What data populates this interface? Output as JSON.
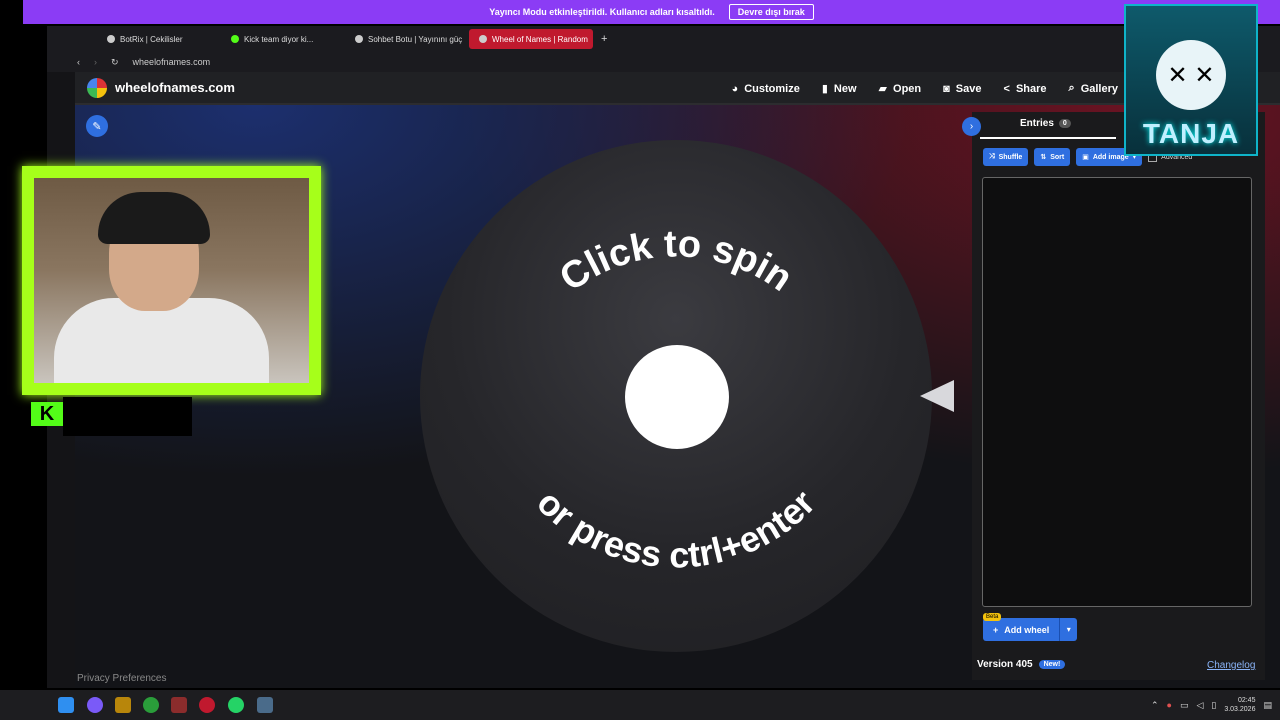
{
  "banner": {
    "message": "Yayıncı Modu etkinleştirildi. Kullanıcı adları kısaltıldı.",
    "button": "Devre dışı bırak"
  },
  "browser": {
    "tabs": [
      {
        "label": "BotRix | Cekilisler"
      },
      {
        "label": "Kick team diyor ki..."
      },
      {
        "label": "Sohbet Botu | Yayınını güç"
      },
      {
        "label": "Wheel of Names | Random"
      }
    ],
    "new_tab": "+",
    "url": "wheelofnames.com"
  },
  "site": {
    "name": "wheelofnames.com",
    "nav": [
      {
        "label": "Customize",
        "icon": "palette-icon",
        "glyph": "◕"
      },
      {
        "label": "New",
        "icon": "file-icon",
        "glyph": "▮"
      },
      {
        "label": "Open",
        "icon": "folder-icon",
        "glyph": "▰"
      },
      {
        "label": "Save",
        "icon": "save-icon",
        "glyph": "◙"
      },
      {
        "label": "Share",
        "icon": "share-icon",
        "glyph": "<"
      },
      {
        "label": "Gallery",
        "icon": "search-icon",
        "glyph": "⌕"
      }
    ]
  },
  "wheel": {
    "top_text": "Click to spin",
    "bottom_text": "or press ctrl+enter"
  },
  "panel": {
    "entries_label": "Entries",
    "entries_count": "0",
    "shuffle": "Shuffle",
    "sort": "Sort",
    "add_image": "Add image",
    "advanced": "Advanced",
    "add_wheel": "Add wheel",
    "beta": "Beta",
    "version": "Version 405",
    "new_badge": "New!",
    "changelog": "Changelog"
  },
  "privacy": "Privacy Preferences",
  "overlay": {
    "kick_letter": "K",
    "tanja_text": "TANJA"
  },
  "taskbar": {
    "time": "02:45",
    "date": "3.03.2026"
  },
  "colors": {
    "accent": "#2f6fe0",
    "banner": "#8b3cf5",
    "kick": "#53fc18",
    "active_tab": "#c0192e"
  }
}
